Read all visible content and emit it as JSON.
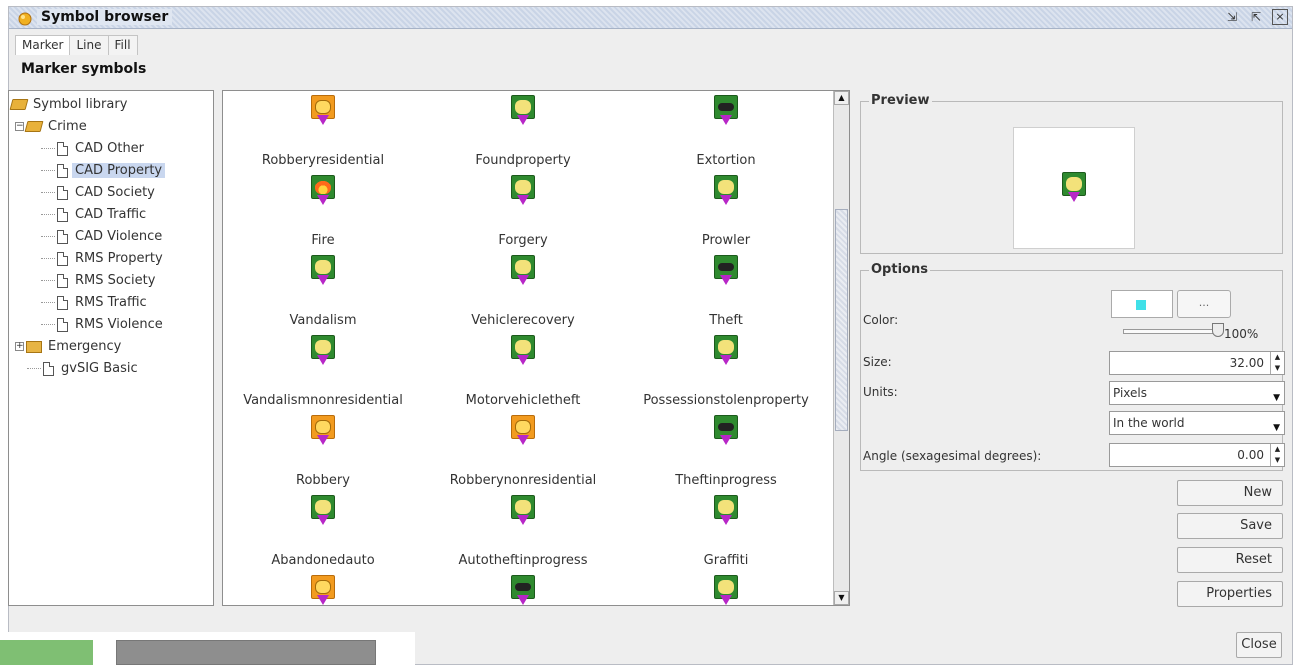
{
  "window": {
    "title": "Symbol browser",
    "controls": [
      "minimize",
      "maximize",
      "close"
    ]
  },
  "tabs": [
    {
      "label": "Marker",
      "active": true
    },
    {
      "label": "Line",
      "active": false
    },
    {
      "label": "Fill",
      "active": false
    }
  ],
  "section_title": "Marker symbols",
  "tree": {
    "root": "Symbol library",
    "crime": "Crime",
    "crime_children": [
      "CAD Other",
      "CAD Property",
      "CAD Society",
      "CAD Traffic",
      "CAD Violence",
      "RMS Property",
      "RMS Society",
      "RMS Traffic",
      "RMS Violence"
    ],
    "selected": "CAD Property",
    "emergency": "Emergency",
    "gvsig": "gvSIG Basic"
  },
  "symbols": [
    {
      "label": "Robberyresidential",
      "icon": "robbery-residential-icon",
      "style": "orange"
    },
    {
      "label": "Foundproperty",
      "icon": "found-property-icon",
      "style": "green"
    },
    {
      "label": "Extortion",
      "icon": "extortion-icon",
      "style": "dark"
    },
    {
      "label": "Fire",
      "icon": "fire-icon",
      "style": "flame"
    },
    {
      "label": "Forgery",
      "icon": "forgery-icon",
      "style": "green"
    },
    {
      "label": "Prowler",
      "icon": "prowler-icon",
      "style": "green"
    },
    {
      "label": "Vandalism",
      "icon": "vandalism-icon",
      "style": "green"
    },
    {
      "label": "Vehiclerecovery",
      "icon": "vehicle-recovery-icon",
      "style": "green"
    },
    {
      "label": "Theft",
      "icon": "theft-icon",
      "style": "dark"
    },
    {
      "label": "Vandalismnonresidential",
      "icon": "vandalism-nonresidential-icon",
      "style": "green"
    },
    {
      "label": "Motorvehicletheft",
      "icon": "motor-vehicle-theft-icon",
      "style": "green"
    },
    {
      "label": "Possessionstolenproperty",
      "icon": "possession-stolen-property-icon",
      "style": "green"
    },
    {
      "label": "Robbery",
      "icon": "robbery-icon",
      "style": "orange"
    },
    {
      "label": "Robberynonresidential",
      "icon": "robbery-nonresidential-icon",
      "style": "orange"
    },
    {
      "label": "Theftinprogress",
      "icon": "theft-in-progress-icon",
      "style": "dark"
    },
    {
      "label": "Abandonedauto",
      "icon": "abandoned-auto-icon",
      "style": "green"
    },
    {
      "label": "Autotheftinprogress",
      "icon": "auto-theft-in-progress-icon",
      "style": "green"
    },
    {
      "label": "Graffiti",
      "icon": "graffiti-icon",
      "style": "green"
    },
    {
      "label": "",
      "icon": "robbery-icon",
      "style": "orange"
    },
    {
      "label": "",
      "icon": "mask-icon",
      "style": "dark"
    },
    {
      "label": "",
      "icon": "cart-icon",
      "style": "green"
    }
  ],
  "preview": {
    "label": "Preview",
    "icon": "vehicle-recovery-icon"
  },
  "options": {
    "label": "Options",
    "color_label": "Color:",
    "color_value": "#40e0e8",
    "color_button": "...",
    "opacity": "100%",
    "size_label": "Size:",
    "size_value": "32.00",
    "units_label": "Units:",
    "units_value": "Pixels",
    "units_ref_value": "In the world",
    "angle_label": "Angle (sexagesimal degrees):",
    "angle_value": "0.00"
  },
  "buttons": {
    "new": "New",
    "save": "Save",
    "reset": "Reset",
    "properties": "Properties",
    "close": "Close"
  },
  "colors": {
    "titlebar": "#c9d4e6",
    "marker_green": "#2f8a2f",
    "marker_orange": "#f29b1f",
    "marker_pin": "#b726c7",
    "tree_selected": "#c9d7ef"
  }
}
